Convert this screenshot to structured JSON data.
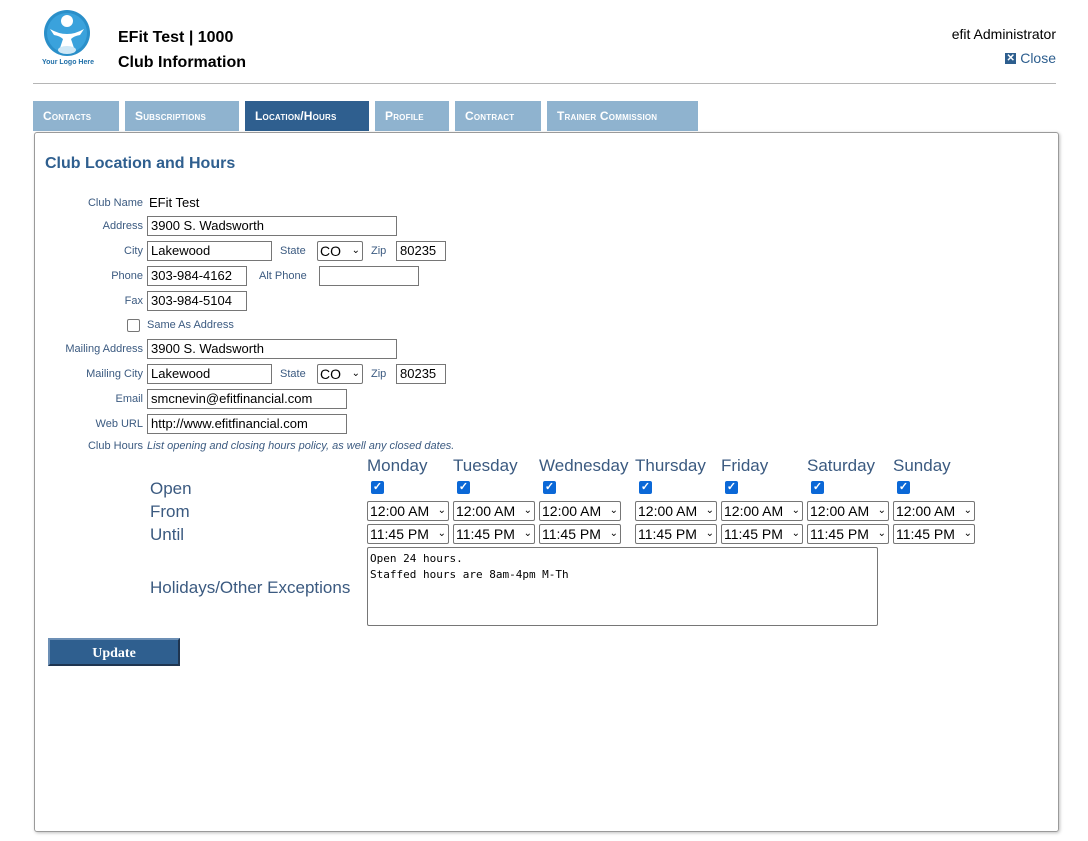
{
  "header": {
    "logo_text": "Your Logo Here",
    "title": "EFit Test | 1000",
    "subtitle": "Club Information",
    "user": "efit Administrator",
    "close_label": "Close"
  },
  "tabs": [
    {
      "label": "Contacts",
      "active": false
    },
    {
      "label": "Subscriptions",
      "active": false
    },
    {
      "label": "Location/Hours",
      "active": true
    },
    {
      "label": "Profile",
      "active": false
    },
    {
      "label": "Contract",
      "active": false
    },
    {
      "label": "Trainer Commission",
      "active": false
    }
  ],
  "section_title": "Club Location and Hours",
  "form": {
    "club_name_label": "Club Name",
    "club_name": "EFit Test",
    "address_label": "Address",
    "address": "3900 S. Wadsworth",
    "city_label": "City",
    "city": "Lakewood",
    "state_label": "State",
    "state": "CO",
    "zip_label": "Zip",
    "zip": "80235",
    "phone_label": "Phone",
    "phone": "303-984-4162",
    "alt_phone_label": "Alt Phone",
    "alt_phone": "",
    "fax_label": "Fax",
    "fax": "303-984-5104",
    "same_as_address_label": "Same As Address",
    "same_as_address": false,
    "mailing_address_label": "Mailing Address",
    "mailing_address": "3900 S. Wadsworth",
    "mailing_city_label": "Mailing City",
    "mailing_city": "Lakewood",
    "mailing_state_label": "State",
    "mailing_state": "CO",
    "mailing_zip_label": "Zip",
    "mailing_zip": "80235",
    "email_label": "Email",
    "email": "smcnevin@efitfinancial.com",
    "web_url_label": "Web URL",
    "web_url": "http://www.efitfinancial.com",
    "club_hours_label": "Club Hours",
    "club_hours_hint": "List opening and closing hours policy, as well any closed dates."
  },
  "hours": {
    "open_label": "Open",
    "from_label": "From",
    "until_label": "Until",
    "days": [
      {
        "name": "Monday",
        "open": true,
        "from": "12:00 AM",
        "until": "11:45 PM"
      },
      {
        "name": "Tuesday",
        "open": true,
        "from": "12:00 AM",
        "until": "11:45 PM"
      },
      {
        "name": "Wednesday",
        "open": true,
        "from": "12:00 AM",
        "until": "11:45 PM"
      },
      {
        "name": "Thursday",
        "open": true,
        "from": "12:00 AM",
        "until": "11:45 PM"
      },
      {
        "name": "Friday",
        "open": true,
        "from": "12:00 AM",
        "until": "11:45 PM"
      },
      {
        "name": "Saturday",
        "open": true,
        "from": "12:00 AM",
        "until": "11:45 PM"
      },
      {
        "name": "Sunday",
        "open": true,
        "from": "12:00 AM",
        "until": "11:45 PM"
      }
    ],
    "exceptions_label": "Holidays/Other Exceptions",
    "exceptions_text": "Open 24 hours.\nStaffed hours are 8am-4pm M-Th"
  },
  "update_label": "Update",
  "colors": {
    "accent": "#2f5f8f",
    "tab_inactive": "#8fb3cf",
    "label": "#3b5a80",
    "checkbox": "#0b68d7"
  }
}
